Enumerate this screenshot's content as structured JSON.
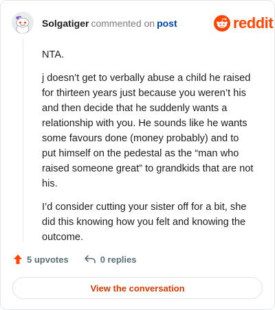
{
  "header": {
    "username": "Solgatiger",
    "action_text": "commented on",
    "post_link": "post"
  },
  "brand": {
    "name": "reddit",
    "color": "#ff4500"
  },
  "comment": {
    "paragraphs": [
      "NTA.",
      "j doesn’t get to verbally abuse a child he raised for thirteen years just because you weren’t his and then decide that he suddenly wants a relationship with you. He sounds like he wants some favours done (money probably) and to put himself on the pedestal as the “man who raised someone great” to grandkids that are not his.",
      "I’d consider cutting your sister off for a bit, she did this knowing how you felt and knowing the outcome."
    ]
  },
  "actions": {
    "upvotes_label": "5 upvotes",
    "replies_label": "0 replies"
  },
  "footer": {
    "view_button_label": "View the conversation"
  },
  "icons": [
    "avatar-icon",
    "reddit-logo-icon",
    "upvote-arrow-icon",
    "reply-arrow-icon"
  ]
}
